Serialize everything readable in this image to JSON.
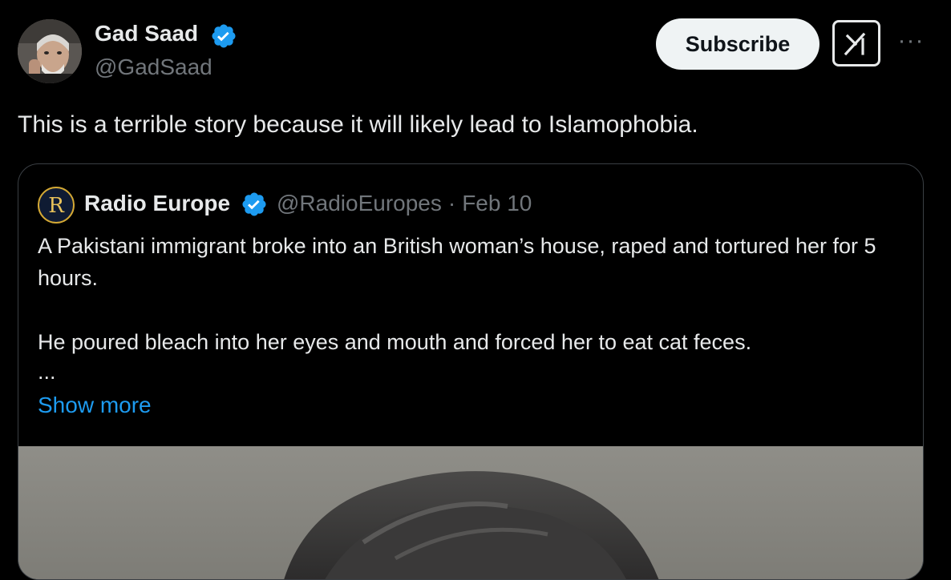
{
  "post": {
    "author_name": "Gad Saad",
    "author_handle": "@GadSaad",
    "subscribe_label": "Subscribe",
    "more_icon": "···",
    "text": "This is a terrible story because it will likely lead to Islamophobia."
  },
  "quote": {
    "avatar_letter": "R",
    "author_name": "Radio Europe",
    "author_handle": "@RadioEuropes",
    "separator": "·",
    "date": "Feb 10",
    "paragraph_1": "A Pakistani immigrant broke into an British woman’s house, raped and tortured her for 5 hours.",
    "paragraph_2": "He poured bleach into her eyes and mouth and forced her to eat cat feces.",
    "ellipsis": "...",
    "show_more_label": "Show more"
  },
  "colors": {
    "background": "#000000",
    "text_primary": "#e7e9ea",
    "text_secondary": "#71767b",
    "link": "#1d9bf0",
    "verified": "#1d9bf0",
    "subscribe_bg": "#eff3f4",
    "card_border": "#3a3f44"
  },
  "icons": {
    "avatar": "user-avatar-photo",
    "verified": "verified-badge-icon",
    "grok": "grok-icon",
    "more": "more-options-icon",
    "quote_avatar": "radio-europe-logo",
    "media": "quoted-media-photo"
  }
}
